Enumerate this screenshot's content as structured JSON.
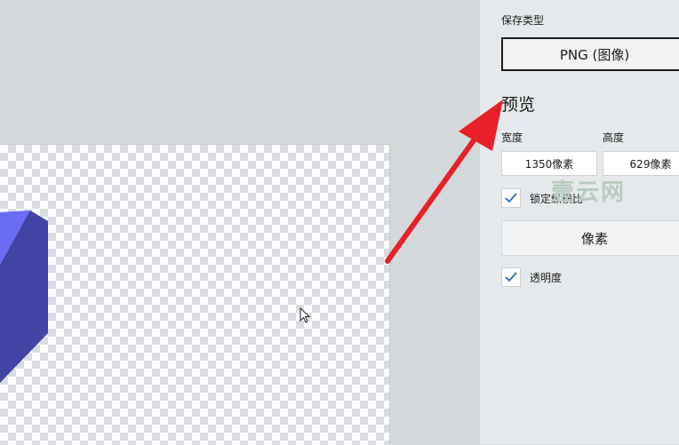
{
  "export_panel": {
    "save_type_label": "保存类型",
    "save_type_value": "PNG (图像)",
    "preview_title": "预览",
    "width_label": "宽度",
    "height_label": "高度",
    "width_value": "1350像素",
    "height_value": "629像素",
    "lock_aspect_label": "锁定纵横比",
    "lock_aspect_checked": true,
    "unit_button_label": "像素",
    "transparency_label": "透明度",
    "transparency_checked": true
  },
  "watermark": "壹云网",
  "colors": {
    "cube_front": "#6b6cf6",
    "cube_side": "#4143a5",
    "arrow": "#e8202a",
    "checkmark": "#2b6cb0"
  },
  "icons": [
    "checkmark-icon",
    "mouse-cursor-icon",
    "red-arrow"
  ]
}
